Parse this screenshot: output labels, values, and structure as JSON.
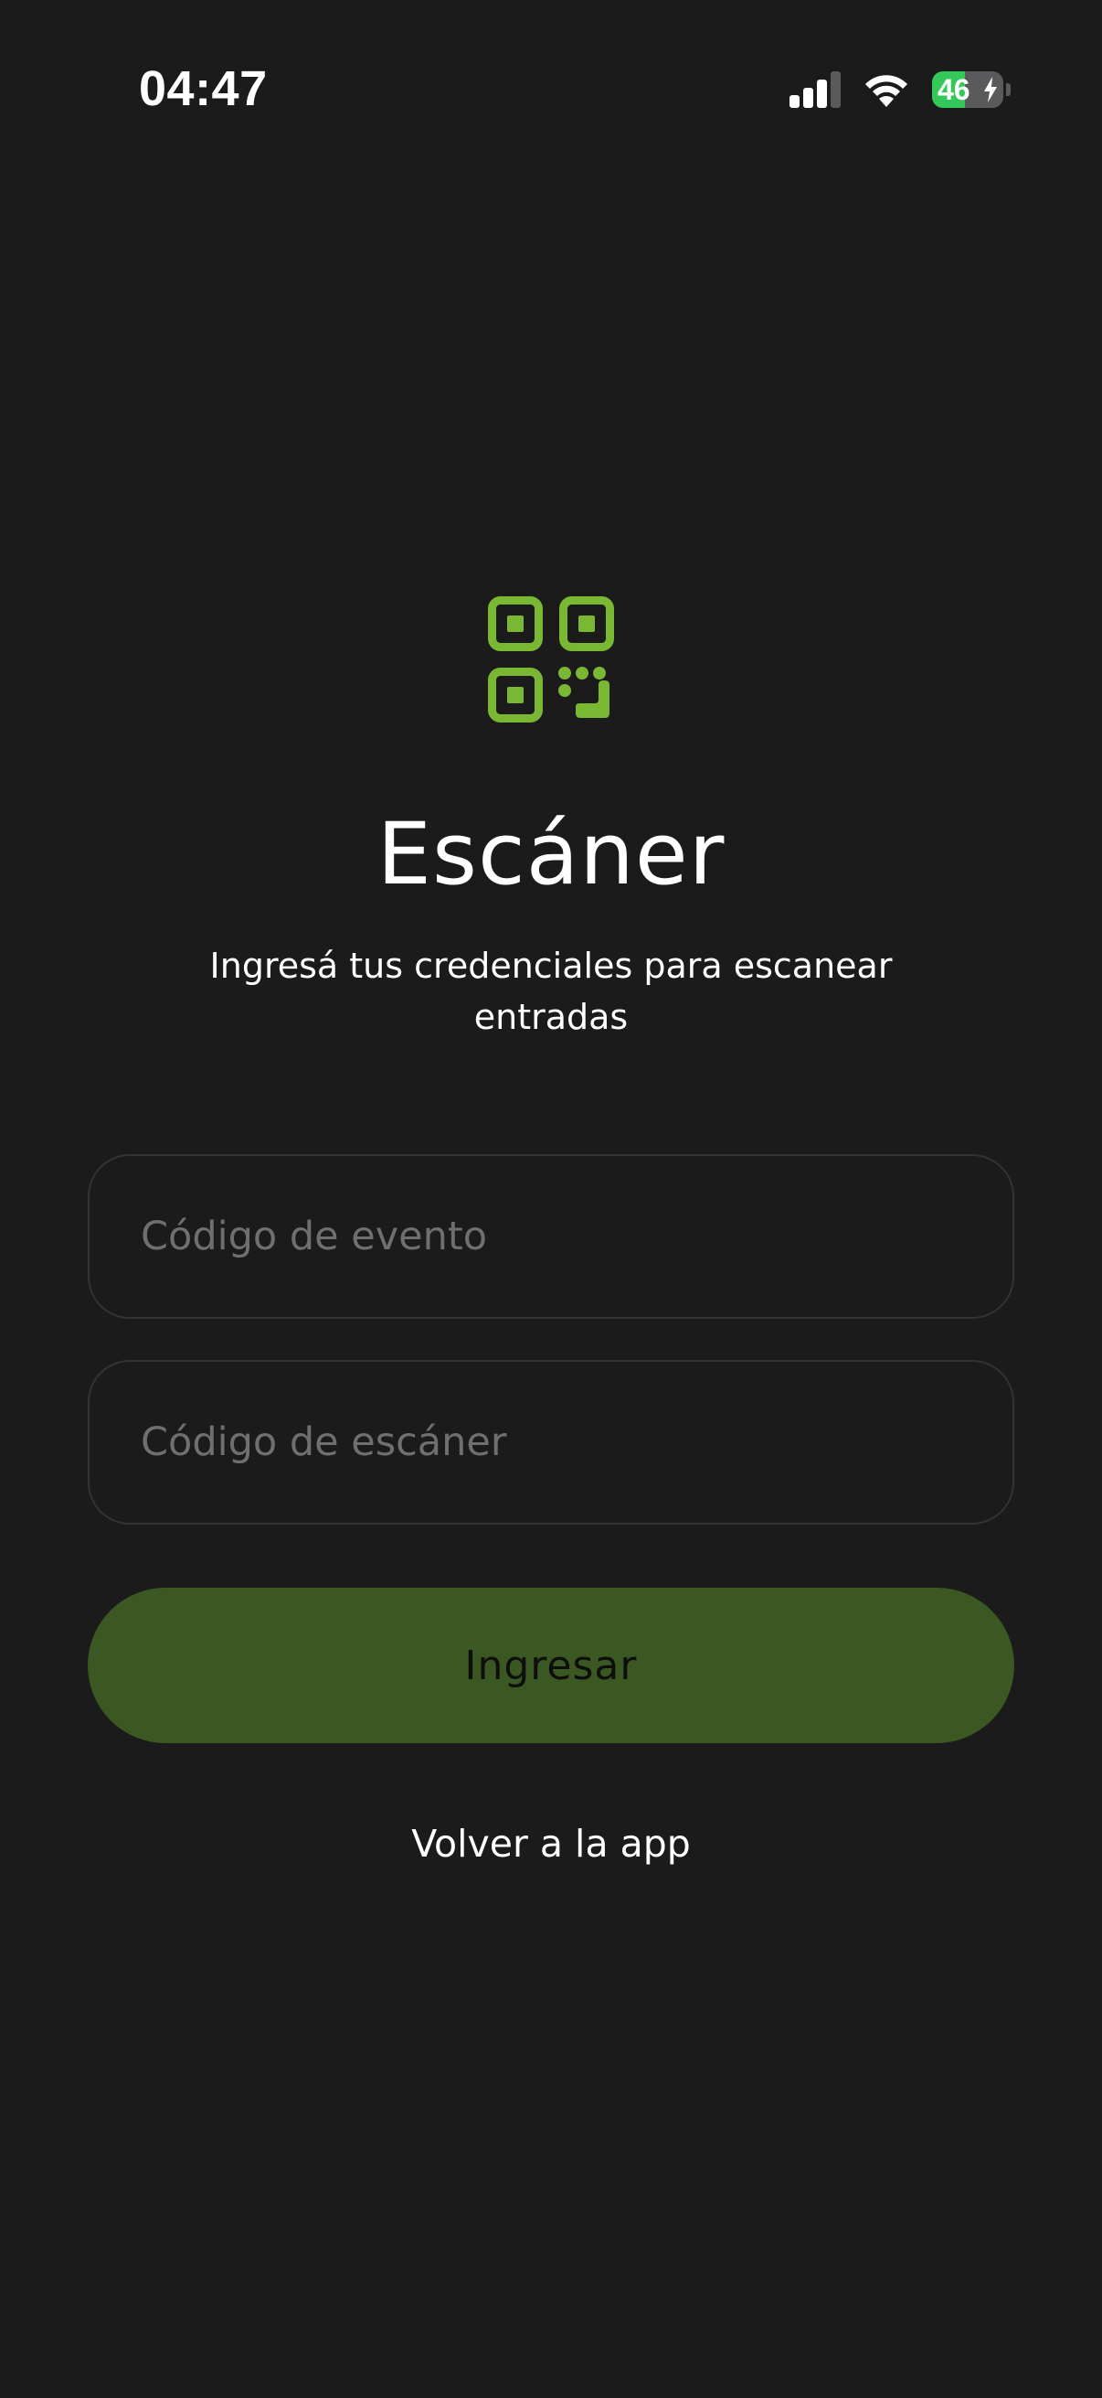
{
  "status_bar": {
    "time": "04:47",
    "battery": {
      "level_percent": 46,
      "label": "46",
      "charging": true
    }
  },
  "scanner": {
    "icon": "qr-code-icon",
    "title": "Escáner",
    "subtitle": "Ingresá tus credenciales para escanear entradas"
  },
  "form": {
    "event_code": {
      "placeholder": "Código de evento",
      "value": ""
    },
    "scanner_code": {
      "placeholder": "Código de escáner",
      "value": ""
    },
    "submit_label": "Ingresar"
  },
  "back_link_label": "Volver a la app",
  "colors": {
    "background": "#1b1b1c",
    "accent": "#7ab834",
    "button": "#3b5823",
    "battery": "#34c759"
  }
}
